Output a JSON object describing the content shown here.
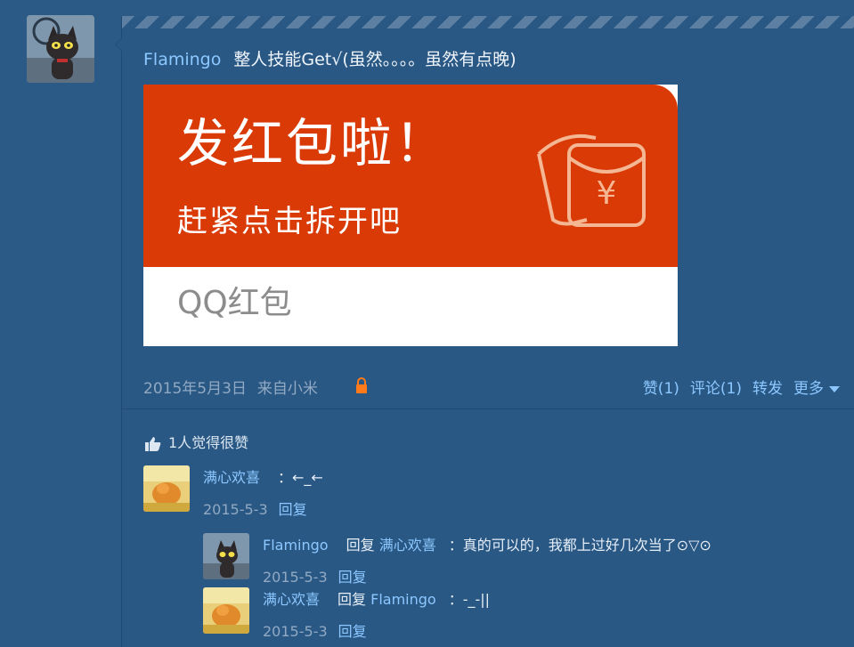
{
  "post": {
    "author": "Flamingo",
    "text": "整人技能Get√(虽然。。。。虽然有点晚)",
    "image": {
      "title": "发红包啦！",
      "subtitle": "赶紧点击拆开吧",
      "footer": "QQ红包",
      "accent_color": "#d93a06"
    },
    "date": "2015年5月3日",
    "source": "来自小米",
    "actions": {
      "like": "赞(1)",
      "comment": "评论(1)",
      "repost": "转发",
      "more": "更多"
    }
  },
  "likes_summary": "1人觉得很赞",
  "comments": [
    {
      "author": "满心欢喜",
      "text": "：←_←",
      "date": "2015-5-3",
      "reply_label": "回复"
    }
  ],
  "replies": [
    {
      "author": "Flamingo",
      "reply_word": "回复",
      "target": "满心欢喜",
      "text": "：真的可以的，我都上过好几次当了⊙▽⊙",
      "date": "2015-5-3",
      "reply_label": "回复"
    },
    {
      "author": "满心欢喜",
      "reply_word": "回复",
      "target": "Flamingo",
      "text": "：-_-||",
      "date": "2015-5-3",
      "reply_label": "回复"
    }
  ],
  "colors": {
    "background": "#2b5a86",
    "link": "#8cc8ff",
    "lock": "#ff7a1a"
  }
}
